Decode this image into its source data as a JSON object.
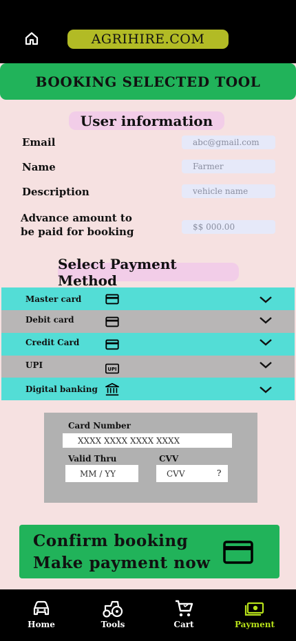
{
  "header": {
    "brand": "AGRIHIRE.COM",
    "home_icon": "home-icon"
  },
  "banner": {
    "title": "BOOKING SELECTED TOOL"
  },
  "user_info": {
    "title": "User information",
    "email_label": "Email",
    "email_placeholder": "abc@gmail.com",
    "name_label": "Name",
    "name_placeholder": "Farmer",
    "description_label": "Description",
    "description_placeholder": "vehicle name",
    "advance_label": "Advance amount to be paid for booking",
    "advance_placeholder": "$$ 000.00"
  },
  "payment": {
    "title": "Select Payment Method",
    "methods": [
      {
        "label": "Master card",
        "icon": "credit-card-icon",
        "color": "#53ddd6"
      },
      {
        "label": "Debit card",
        "icon": "credit-card-icon",
        "color": "#b8b6b6"
      },
      {
        "label": "Credit Card",
        "icon": "credit-card-icon",
        "color": "#53ddd6"
      },
      {
        "label": "UPI",
        "icon": "upi-icon",
        "color": "#b8b6b6"
      },
      {
        "label": "Digital banking",
        "icon": "bank-icon",
        "color": "#53ddd6"
      }
    ]
  },
  "card_form": {
    "card_number_label": "Card Number",
    "card_number_placeholder": "XXXX XXXX XXXX XXXX",
    "valid_thru_label": "Valid Thru",
    "valid_thru_placeholder": "MM / YY",
    "cvv_label": "CVV",
    "cvv_placeholder": "CVV",
    "cvv_help": "?"
  },
  "confirm": {
    "line1": "Confirm booking",
    "line2": "Make payment now",
    "icon": "credit-card-icon"
  },
  "nav": {
    "items": [
      {
        "label": "Home",
        "icon": "car-icon",
        "active": false
      },
      {
        "label": "Tools",
        "icon": "tractor-icon",
        "active": false
      },
      {
        "label": "Cart",
        "icon": "cart-icon",
        "active": false
      },
      {
        "label": "Payment",
        "icon": "payment-icon",
        "active": true
      }
    ]
  },
  "colors": {
    "background": "#f6e1e1",
    "accent_green": "#21b35a",
    "brand_olive": "#b2bb25",
    "teal_row": "#53ddd6",
    "gray_row": "#b8b6b6",
    "active_nav": "#b8e21a"
  }
}
